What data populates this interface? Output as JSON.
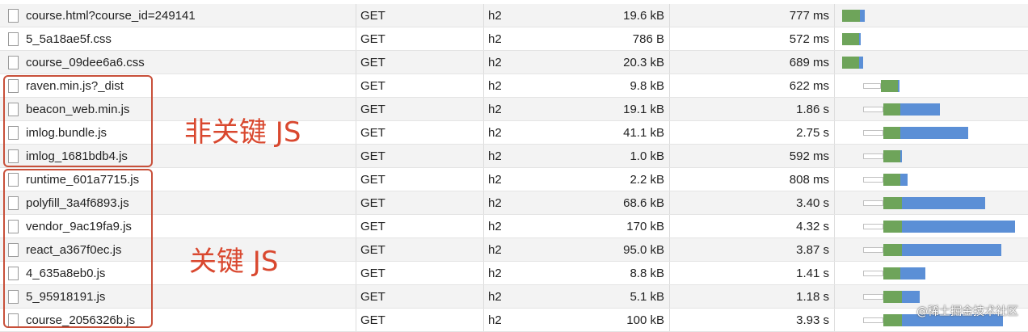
{
  "network": {
    "rows": [
      {
        "name": "course.html?course_id=249141",
        "method": "GET",
        "protocol": "h2",
        "size": "19.6 kB",
        "time": "777 ms",
        "timing": {
          "queue": 0.0,
          "wait": 0.42,
          "download": 0.13
        }
      },
      {
        "name": "5_5a18ae5f.css",
        "method": "GET",
        "protocol": "h2",
        "size": "786 B",
        "time": "572 ms",
        "timing": {
          "queue": 0.0,
          "wait": 0.4,
          "download": 0.02
        }
      },
      {
        "name": "course_09dee6a6.css",
        "method": "GET",
        "protocol": "h2",
        "size": "20.3 kB",
        "time": "689 ms",
        "timing": {
          "queue": 0.0,
          "wait": 0.4,
          "download": 0.1
        }
      },
      {
        "name": "raven.min.js?_dist",
        "method": "GET",
        "protocol": "h2",
        "size": "9.8 kB",
        "time": "622 ms",
        "timing": {
          "queue": 0.48,
          "wait": 0.4,
          "download": 0.04
        }
      },
      {
        "name": "beacon_web.min.js",
        "method": "GET",
        "protocol": "h2",
        "size": "19.1 kB",
        "time": "1.86 s",
        "timing": {
          "queue": 0.56,
          "wait": 0.4,
          "download": 1.0
        }
      },
      {
        "name": "imlog.bundle.js",
        "method": "GET",
        "protocol": "h2",
        "size": "41.1 kB",
        "time": "2.75 s",
        "timing": {
          "queue": 0.56,
          "wait": 0.4,
          "download": 1.7
        }
      },
      {
        "name": "imlog_1681bdb4.js",
        "method": "GET",
        "protocol": "h2",
        "size": "1.0 kB",
        "time": "592 ms",
        "timing": {
          "queue": 0.56,
          "wait": 0.4,
          "download": 0.02
        }
      },
      {
        "name": "runtime_601a7715.js",
        "method": "GET",
        "protocol": "h2",
        "size": "2.2 kB",
        "time": "808 ms",
        "timing": {
          "queue": 0.56,
          "wait": 0.4,
          "download": 0.18
        }
      },
      {
        "name": "polyfill_3a4f6893.js",
        "method": "GET",
        "protocol": "h2",
        "size": "68.6 kB",
        "time": "3.40 s",
        "timing": {
          "queue": 0.56,
          "wait": 0.44,
          "download": 2.1
        }
      },
      {
        "name": "vendor_9ac19fa9.js",
        "method": "GET",
        "protocol": "h2",
        "size": "170 kB",
        "time": "4.32 s",
        "timing": {
          "queue": 0.56,
          "wait": 0.44,
          "download": 2.85
        }
      },
      {
        "name": "react_a367f0ec.js",
        "method": "GET",
        "protocol": "h2",
        "size": "95.0 kB",
        "time": "3.87 s",
        "timing": {
          "queue": 0.56,
          "wait": 0.44,
          "download": 2.5
        }
      },
      {
        "name": "4_635a8eb0.js",
        "method": "GET",
        "protocol": "h2",
        "size": "8.8 kB",
        "time": "1.41 s",
        "timing": {
          "queue": 0.56,
          "wait": 0.4,
          "download": 0.62
        }
      },
      {
        "name": "5_95918191.js",
        "method": "GET",
        "protocol": "h2",
        "size": "5.1 kB",
        "time": "1.18 s",
        "timing": {
          "queue": 0.56,
          "wait": 0.44,
          "download": 0.44
        }
      },
      {
        "name": "course_2056326b.js",
        "method": "GET",
        "protocol": "h2",
        "size": "100 kB",
        "time": "3.93 s",
        "timing": {
          "queue": 0.56,
          "wait": 0.44,
          "download": 2.55
        }
      }
    ]
  },
  "annotations": {
    "non_critical_label": "非关键 JS",
    "critical_label": "关键 JS"
  },
  "watermark": "@稀土掘金技术社区",
  "colors": {
    "wait": "#6ea45a",
    "download": "#5b8fd6",
    "annotation": "#c8503a"
  }
}
